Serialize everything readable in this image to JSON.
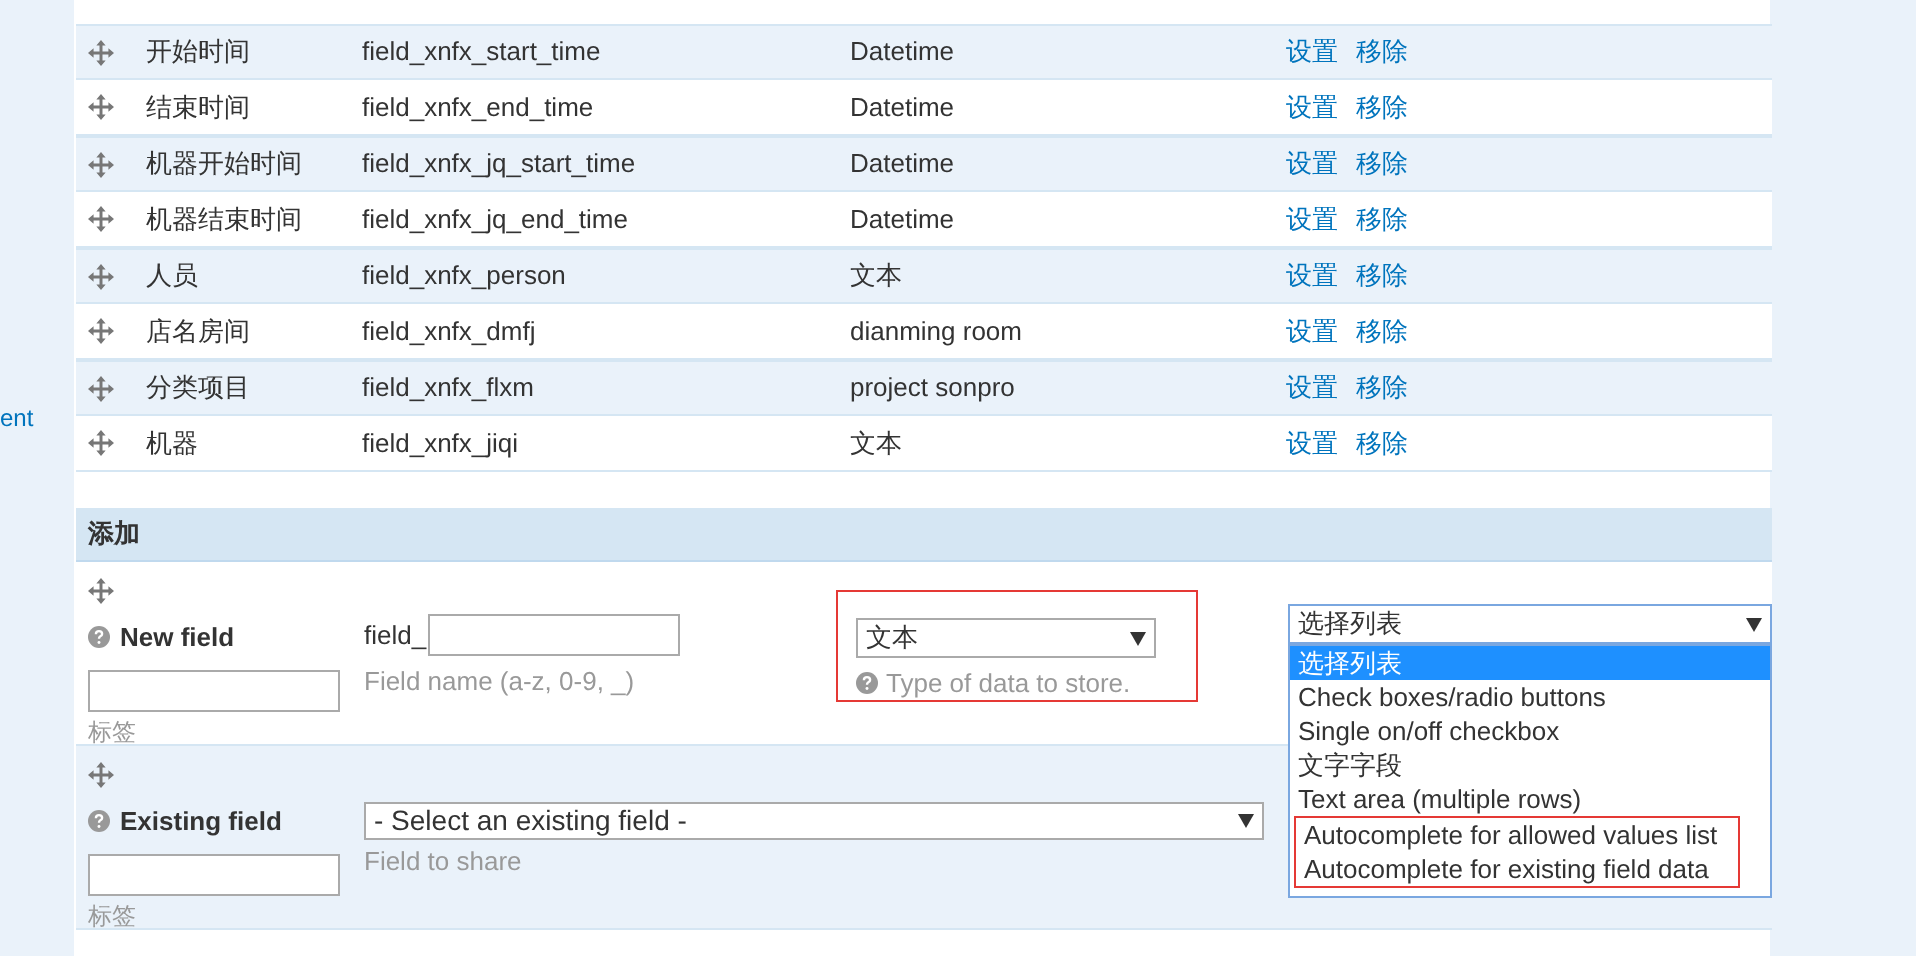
{
  "sidebar": {
    "link": "ent"
  },
  "fields_table": {
    "rows": [
      {
        "label": "开始时间",
        "machine_name": "field_xnfx_start_time",
        "type": "Datetime",
        "actions": [
          "设置",
          "移除"
        ]
      },
      {
        "label": "结束时间",
        "machine_name": "field_xnfx_end_time",
        "type": "Datetime",
        "actions": [
          "设置",
          "移除"
        ]
      },
      {
        "label": "机器开始时间",
        "machine_name": "field_xnfx_jq_start_time",
        "type": "Datetime",
        "actions": [
          "设置",
          "移除"
        ]
      },
      {
        "label": "机器结束时间",
        "machine_name": "field_xnfx_jq_end_time",
        "type": "Datetime",
        "actions": [
          "设置",
          "移除"
        ]
      },
      {
        "label": "人员",
        "machine_name": "field_xnfx_person",
        "type": "文本",
        "actions": [
          "设置",
          "移除"
        ]
      },
      {
        "label": "店名房间",
        "machine_name": "field_xnfx_dmfj",
        "type": "dianming room",
        "actions": [
          "设置",
          "移除"
        ]
      },
      {
        "label": "分类项目",
        "machine_name": "field_xnfx_flxm",
        "type": "project sonpro",
        "actions": [
          "设置",
          "移除"
        ]
      },
      {
        "label": "机器",
        "machine_name": "field_xnfx_jiqi",
        "type": "文本",
        "actions": [
          "设置",
          "移除"
        ]
      }
    ]
  },
  "add_section": {
    "title": "添加",
    "new_field": {
      "title": "New field",
      "label_hint": "标签",
      "prefix": "field_",
      "name_hint": "Field name (a-z, 0-9, _)",
      "type_select": {
        "value": "文本",
        "hint": "Type of data to store.",
        "highlighted": true
      },
      "widget_select": {
        "value": "选择列表",
        "expanded": true,
        "options": [
          {
            "label": "选择列表",
            "selected": true,
            "highlighted": false
          },
          {
            "label": "Check boxes/radio buttons",
            "selected": false,
            "highlighted": false
          },
          {
            "label": "Single on/off checkbox",
            "selected": false,
            "highlighted": false
          },
          {
            "label": "文字字段",
            "selected": false,
            "highlighted": false
          },
          {
            "label": "Text area (multiple rows)",
            "selected": false,
            "highlighted": false
          },
          {
            "label": "Autocomplete for allowed values list",
            "selected": false,
            "highlighted": true
          },
          {
            "label": "Autocomplete for existing field data",
            "selected": false,
            "highlighted": true
          }
        ]
      }
    },
    "existing_field": {
      "title": "Existing field",
      "label_hint": "标签",
      "select": {
        "value": "- Select an existing field -"
      },
      "select_hint": "Field to share"
    }
  }
}
